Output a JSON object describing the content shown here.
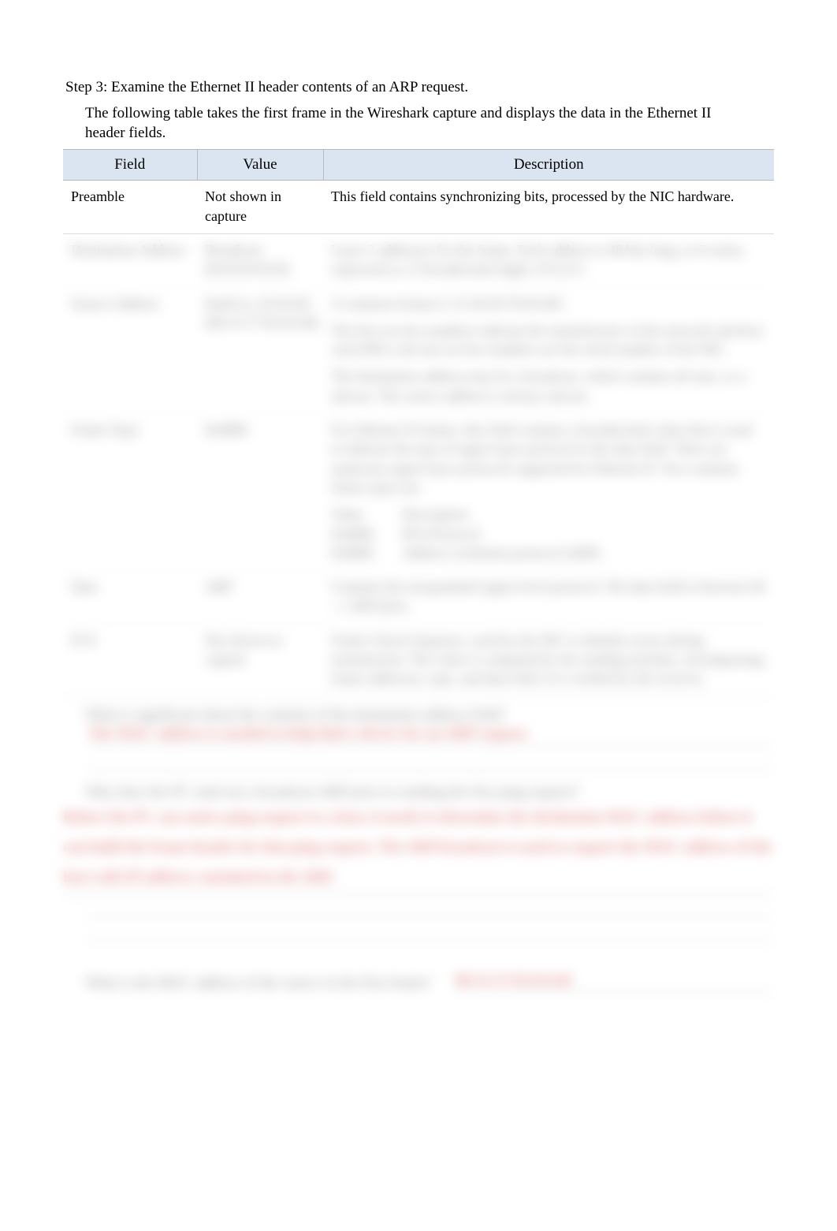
{
  "step_title": "Step 3: Examine the Ethernet II header contents of an ARP request.",
  "intro": "The following table takes the first frame in the      Wireshark   capture and displays the data in the Ethernet II header fields.",
  "table": {
    "headers": {
      "field": "Field",
      "value": "Value",
      "desc": "Description"
    },
    "rows": [
      {
        "field": "Preamble",
        "value": "Not shown in capture",
        "desc": "This field contains synchronizing bits, processed by the NIC hardware."
      },
      {
        "field": "Destination Address",
        "value": "Broadcast (ff:ff:ff:ff:ff:ff)",
        "desc": "Layer 2 addresses for the frame. Each address is 48 bits long, or 6 octets, expressed as 12 hexadecimal digits,        0-9,A-F  ."
      },
      {
        "field": "Source Address",
        "value": "IntelCor_62:62:6d (00:15:17:62:62:6d)",
        "desc_lines": [
          "A common format is 12:34:56:78:9A:BC.",
          "The first six hex numbers indicate the manufacturer of the network interface card (NIC), the last six hex numbers are the serial number of the NIC.",
          "The destination address may be a broadcast, which contains all ones, or a unicast. The source address is always unicast."
        ]
      },
      {
        "field": "Frame Type",
        "value": "0x0806",
        "desc_intro": "For Ethernet II frames, this field contains a hexadecimal value that is used to indicate the type of upper-layer protocol in the data field. There are numerous upper-layer protocols supported by Ethernet II. Two common frame types are:",
        "codes": [
          {
            "k": "Value",
            "v": "Description"
          },
          {
            "k": "0x0800",
            "v": "IPv4 Protocol"
          },
          {
            "k": "0x0806",
            "v": "Address resolution protocol (ARP)"
          }
        ]
      },
      {
        "field": "Data",
        "value": "ARP",
        "desc": "Contains the encapsulated upper-level protocol. The data field is between 46 – 1,500 bytes."
      },
      {
        "field": "FCS",
        "value": "Not shown in capture",
        "desc": "Frame Check Sequence, used by the NIC to identify errors during transmission. The value is computed by the sending machine, encompassing frame addresses, type, and data field. It is verified by the receiver."
      }
    ]
  },
  "qa": [
    {
      "q": "What is significant about the contents of the destination address field?",
      "a": "The MAC address is needed to help find a device for an ARP request."
    },
    {
      "q": "Why does the PC send out a broadcast       ARP prior to sending the first ping request?",
      "a": "Before the PC can send a ping request to a host, it needs to determine the destination MAC address before it can build the frame header for that ping request. The ARP broadcast is used to request the MAC address of the host with IP address contained in the ARP."
    }
  ],
  "mac_q": "What is the MAC address of the source in the first frame?",
  "mac_a": "00:15:17:62:62:6d"
}
